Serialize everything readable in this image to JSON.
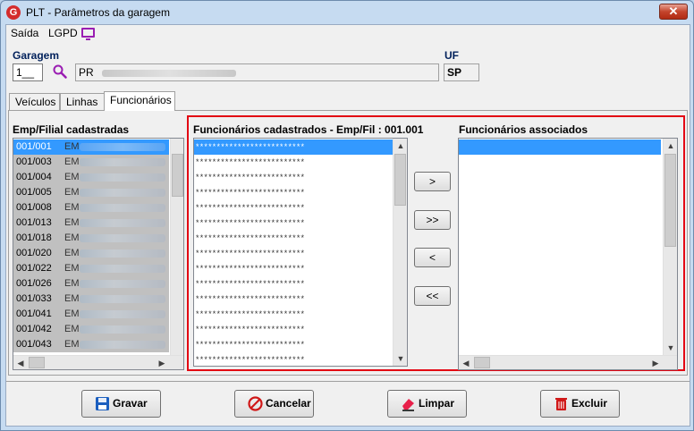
{
  "window": {
    "title": "PLT - Parâmetros da garagem",
    "close_glyph": "✕",
    "app_icon_letter": "G"
  },
  "menu": {
    "items": [
      "Saída",
      "LGPD"
    ]
  },
  "garagem": {
    "label": "Garagem",
    "code": "1__",
    "name": "PR"
  },
  "uf": {
    "label": "UF",
    "value": "SP"
  },
  "tabs": [
    "Veículos",
    "Linhas",
    "Funcionários"
  ],
  "active_tab": "Funcionários",
  "emp_filial": {
    "title": "Emp/Filial cadastradas",
    "rows": [
      {
        "code": "001/001",
        "name": "EM"
      },
      {
        "code": "001/003",
        "name": "EM"
      },
      {
        "code": "001/004",
        "name": "EM"
      },
      {
        "code": "001/005",
        "name": "EM"
      },
      {
        "code": "001/008",
        "name": "EM"
      },
      {
        "code": "001/013",
        "name": "EM"
      },
      {
        "code": "001/018",
        "name": "EM"
      },
      {
        "code": "001/020",
        "name": "EM"
      },
      {
        "code": "001/022",
        "name": "EM"
      },
      {
        "code": "001/026",
        "name": "EM"
      },
      {
        "code": "001/033",
        "name": "EM"
      },
      {
        "code": "001/041",
        "name": "EM"
      },
      {
        "code": "001/042",
        "name": "EM"
      },
      {
        "code": "001/043",
        "name": "EM"
      }
    ]
  },
  "funcionarios_cadastrados": {
    "title": "Funcionários cadastrados - Emp/Fil : 001.001",
    "rows": [
      "**************************",
      "**************************",
      "**************************",
      "**************************",
      "**************************",
      "**************************",
      "**************************",
      "**************************",
      "**************************",
      "**************************",
      "**************************",
      "**************************",
      "**************************",
      "**************************",
      "**************************"
    ]
  },
  "funcionarios_associados": {
    "title": "Funcionários associados"
  },
  "move_buttons": [
    ">",
    ">>",
    "<",
    "<<"
  ],
  "actions": {
    "gravar": "Gravar",
    "cancelar": "Cancelar",
    "limpar": "Limpar",
    "excluir": "Excluir"
  },
  "colors": {
    "selection": "#3399ff",
    "highlight_frame": "#e30613",
    "window_bg": "#c6dbf1"
  }
}
